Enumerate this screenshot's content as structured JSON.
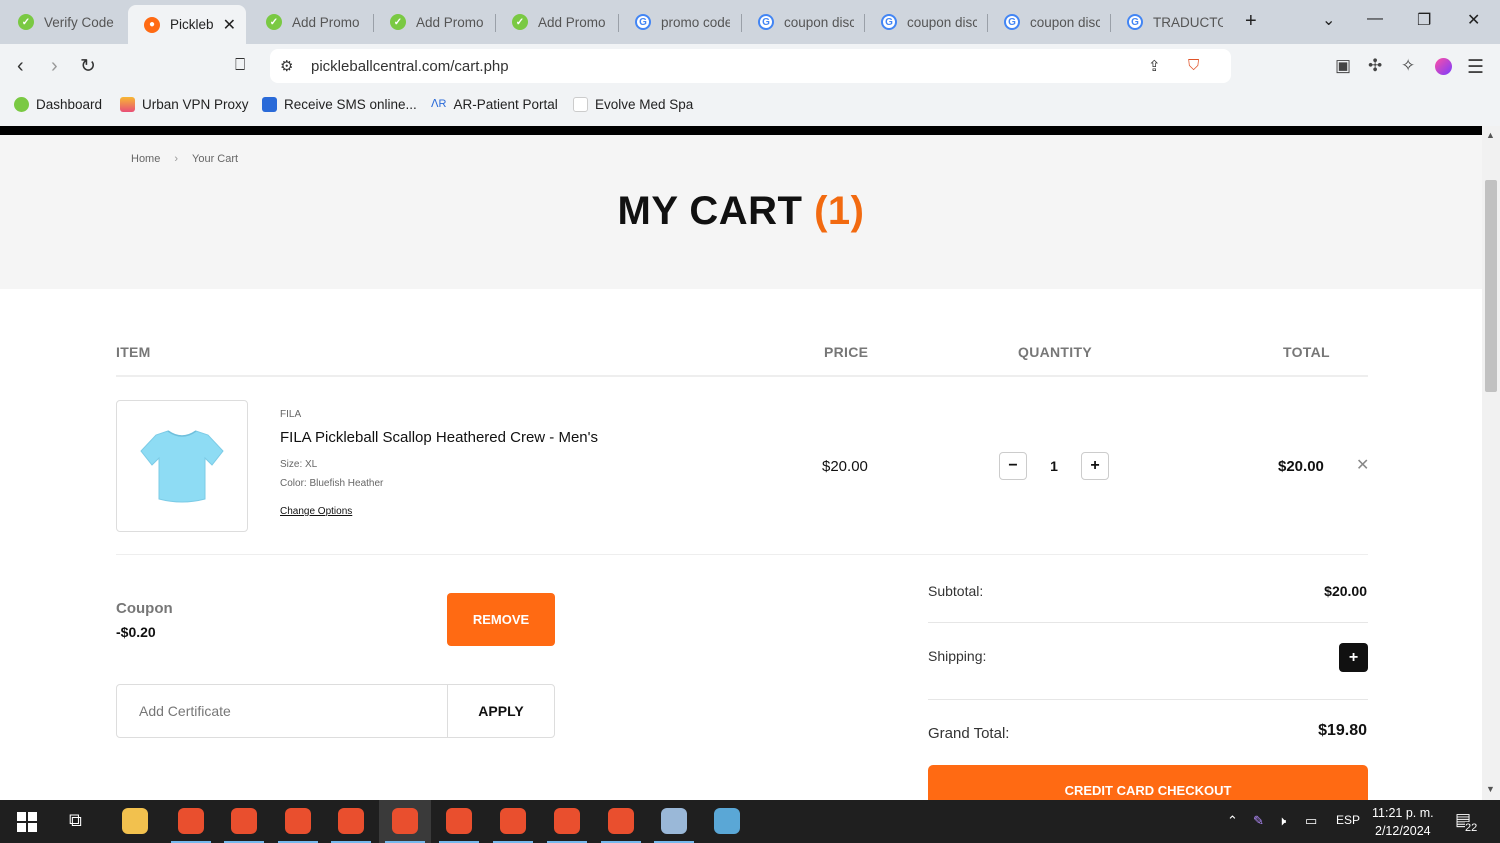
{
  "browser": {
    "tabs": [
      {
        "title": "Verify Code"
      },
      {
        "title": "Pickleb"
      },
      {
        "title": "Add Promo"
      },
      {
        "title": "Add Promo"
      },
      {
        "title": "Add Promo"
      },
      {
        "title": "promo code"
      },
      {
        "title": "coupon disc"
      },
      {
        "title": "coupon disc"
      },
      {
        "title": "coupon disc"
      },
      {
        "title": "TRADUCTOR"
      }
    ],
    "url": "pickleballcentral.com/cart.php",
    "bookmarks": [
      {
        "label": "Dashboard"
      },
      {
        "label": "Urban VPN Proxy"
      },
      {
        "label": "Receive SMS online..."
      },
      {
        "label": "AR-Patient Portal"
      },
      {
        "label": "Evolve Med Spa"
      }
    ]
  },
  "page": {
    "breadcrumb": {
      "home": "Home",
      "current": "Your Cart"
    },
    "title": "MY CART",
    "title_count": "(1)",
    "table_headers": {
      "item": "ITEM",
      "price": "PRICE",
      "quantity": "QUANTITY",
      "total": "TOTAL"
    },
    "item": {
      "brand": "FILA",
      "name": "FILA Pickleball Scallop Heathered Crew - Men's",
      "size": "Size: XL",
      "color": "Color: Bluefish Heather",
      "change_options": "Change Options",
      "price": "$20.00",
      "quantity": "1",
      "total": "$20.00"
    },
    "coupon": {
      "label": "Coupon",
      "value": "-$0.20",
      "remove_label": "REMOVE"
    },
    "certificate": {
      "placeholder": "Add Certificate",
      "apply_label": "APPLY"
    },
    "summary": {
      "subtotal_label": "Subtotal:",
      "subtotal_value": "$20.00",
      "shipping_label": "Shipping:",
      "grand_total_label": "Grand Total:",
      "grand_total_value": "$19.80",
      "checkout_label": "CREDIT CARD CHECKOUT"
    }
  },
  "taskbar": {
    "language": "ESP",
    "time": "11:21 p. m.",
    "date": "2/12/2024",
    "notifications": "22"
  },
  "colors": {
    "accent": "#ff6a13",
    "title_count": "#f26a10"
  }
}
